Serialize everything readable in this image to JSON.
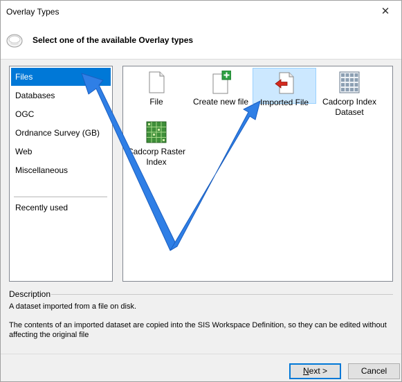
{
  "window": {
    "title": "Overlay Types",
    "close_glyph": "✕"
  },
  "header": {
    "instruction": "Select one of the available Overlay types",
    "icon": "wizard-disc-icon"
  },
  "categories": {
    "items": [
      {
        "label": "Files",
        "selected": true
      },
      {
        "label": "Databases"
      },
      {
        "label": "OGC"
      },
      {
        "label": "Ordnance Survey (GB)"
      },
      {
        "label": "Web"
      },
      {
        "label": "Miscellaneous"
      }
    ],
    "recent_label": "Recently used"
  },
  "overlay_types": [
    {
      "label_lines": [
        "File"
      ],
      "icon": "blank-document-icon"
    },
    {
      "label_lines": [
        "Create new file"
      ],
      "icon": "new-file-icon"
    },
    {
      "label_lines": [
        "Imported File"
      ],
      "icon": "imported-file-icon",
      "selected": true
    },
    {
      "label_lines": [
        "Cadcorp Index",
        "Dataset"
      ],
      "icon": "index-grid-icon"
    },
    {
      "label_lines": [
        "Cadcorp Raster",
        "Index"
      ],
      "icon": "raster-grid-icon"
    }
  ],
  "description": {
    "title": "Description",
    "short": "A dataset imported from a file on disk.",
    "long": "The contents of an imported dataset are copied into the SIS Workspace Definition, so they can be edited without affecting the original file"
  },
  "buttons": {
    "next_mnemonic": "N",
    "next_rest": "ext >",
    "cancel": "Cancel"
  },
  "colors": {
    "selection": "#0078d7",
    "selected_tile": "#cce8ff",
    "annotation_arrow": "#2f7fe6"
  }
}
